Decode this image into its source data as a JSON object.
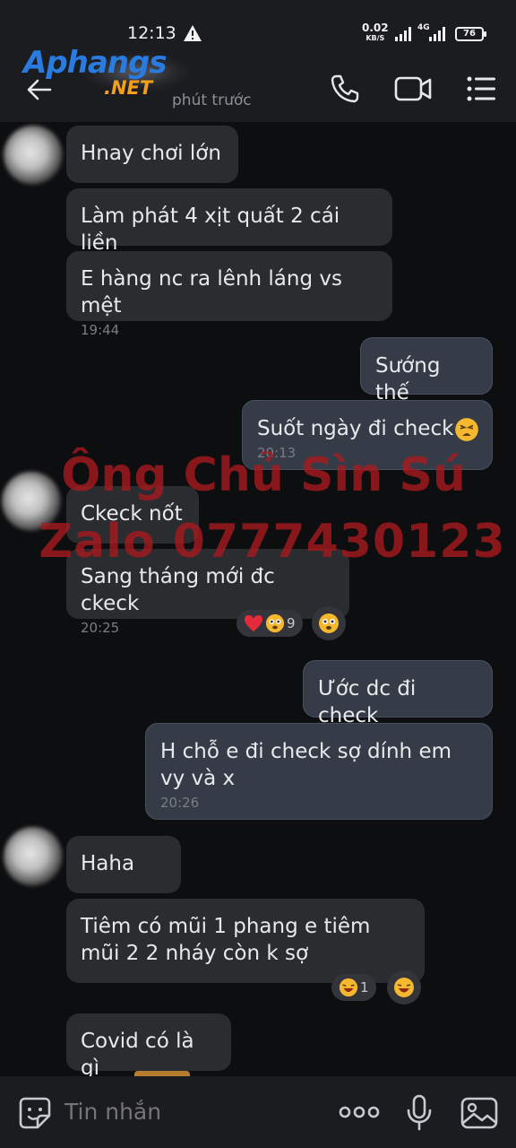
{
  "status_bar": {
    "time": "12:13",
    "net_speed_value": "0.02",
    "net_speed_unit": "KB/S",
    "network": "4G",
    "battery": "76"
  },
  "header": {
    "logo_part1": "Aphangs",
    "logo_part2": ".NET",
    "subtitle": "phút trước"
  },
  "messages": [
    {
      "direction": "in",
      "text": "Hnay chơi lớn"
    },
    {
      "direction": "in",
      "text": "Làm phát 4 xịt quất 2 cái liền"
    },
    {
      "direction": "in",
      "text": "E hàng nc ra lênh láng vs mệt",
      "time": "19:44"
    },
    {
      "direction": "out",
      "text": "Sướng thế"
    },
    {
      "direction": "out",
      "text": "Suốt ngày đi check",
      "time": "20:13",
      "emoji": "tired-face"
    },
    {
      "direction": "in",
      "text": "Ckeck nốt"
    },
    {
      "direction": "in",
      "text": "Sang tháng mới đc ckeck",
      "time": "20:25",
      "reaction_count": "9"
    },
    {
      "direction": "out",
      "text": "Ước dc đi check"
    },
    {
      "direction": "out",
      "text": "H chỗ e đi check sợ dính em vy và x",
      "time": "20:26"
    },
    {
      "direction": "in",
      "text": "Haha"
    },
    {
      "direction": "in",
      "text": "Tiêm có mũi 1 phang e tiêm mũi 2 2 nháy còn k sợ",
      "reaction_count": "1"
    },
    {
      "direction": "in",
      "text": "Covid có là gì"
    }
  ],
  "watermark": {
    "line1": "Ông Chủ Sìn Sú",
    "line2": "Zalo 0777430123"
  },
  "input": {
    "placeholder": "Tin nhắn"
  },
  "colors": {
    "background": "#0d0e10",
    "incoming_bubble": "#2b2c30",
    "outgoing_bubble": "#353c48",
    "watermark": "#aa1a1e"
  }
}
